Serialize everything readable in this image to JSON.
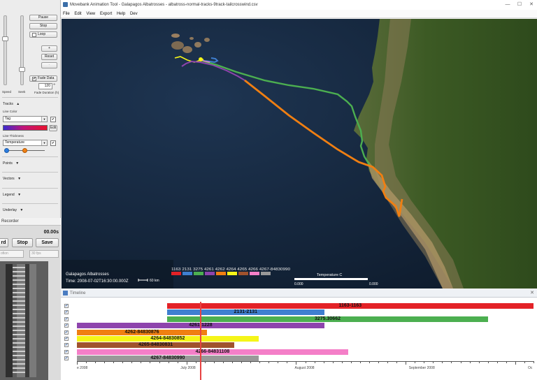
{
  "control_panel": {
    "speed_label": "Speed",
    "seek_label": "Seek",
    "fade_duration_label": "Fade Duration (h)",
    "pause_label": "Pause",
    "stop_label": "Stop",
    "loop_label": "Loop",
    "plus_label": "+",
    "reset_label": "Reset",
    "minus_label": "-",
    "fade_data_label": "Fade Data",
    "fade_duration_value": "120",
    "tracks_section": "Tracks",
    "line_color_label": "Line Color",
    "line_color_value": "Tag",
    "edit_label": "Edit",
    "line_thickness_label": "Line Thickness",
    "line_thickness_value": "Temperature",
    "points_section": "Points",
    "vectors_section": "Vectors",
    "legend_section": "Legend",
    "underlay_section": "Underlay",
    "expand_arrow": "▲",
    "collapse_arrow": "▼",
    "check_mark": "✔",
    "fade_duration_spin": "÷"
  },
  "recorder": {
    "title": "Recorder",
    "time": "00.00s",
    "record_label": "rd",
    "stop_label": "Stop",
    "save_label": "Save",
    "format_value": "ofion",
    "fps_value": "30 fps"
  },
  "window": {
    "title": "Movebank Animation Tool  -  Galapagos Albatrosses  -  albatross-normal-tracks-9track-tailcrosswind.csv",
    "minimize": "—",
    "maximize": "☐",
    "close": "✕"
  },
  "menu": [
    "File",
    "Edit",
    "View",
    "Export",
    "Help",
    "Dev"
  ],
  "map": {
    "dataset_label": "Galapagos Albatrosses",
    "time_label": "Time: 2008-07-02T16:30:00.000Z",
    "scale_label": "60 km",
    "legend_colorbar_label": "1163 2131 3275 4261 4262 4264 4265 4266 4267-84830990",
    "temperature_label": "Temperature C",
    "temp_min": "0.000",
    "temp_max": "0.000",
    "track_colors": [
      "#e32227",
      "#3f7fd0",
      "#4caf50",
      "#8e44ad",
      "#f07f12",
      "#f5f518",
      "#a0522d",
      "#f47fc8",
      "#999999"
    ]
  },
  "timeline": {
    "title": "Timeline",
    "close": "✕",
    "check_mark": "✔",
    "bars": [
      {
        "label": "1163-1163",
        "color": "#e32227",
        "start": 0.197,
        "end": 1.0
      },
      {
        "label": "2131-2131",
        "color": "#3f7fd0",
        "start": 0.197,
        "end": 0.542
      },
      {
        "label": "3275.30662",
        "color": "#4caf50",
        "start": 0.197,
        "end": 0.901
      },
      {
        "label": "4261-1228",
        "color": "#8e44ad",
        "start": 0.0,
        "end": 0.542
      },
      {
        "label": "4262-84830876",
        "color": "#f07f12",
        "start": 0.0,
        "end": 0.285
      },
      {
        "label": "4264-84830852",
        "color": "#f5f518",
        "start": 0.0,
        "end": 0.398
      },
      {
        "label": "4265-84830831",
        "color": "#a0522d",
        "start": 0.0,
        "end": 0.345
      },
      {
        "label": "4266-84831108",
        "color": "#f47fc8",
        "start": 0.0,
        "end": 0.594
      },
      {
        "label": "4267-84830990",
        "color": "#999999",
        "start": 0.0,
        "end": 0.398
      }
    ],
    "axis_labels": [
      "e 2008",
      "July 2008",
      "August 2008",
      "September 2008",
      "Oc"
    ],
    "current_time_fraction": 0.271
  }
}
